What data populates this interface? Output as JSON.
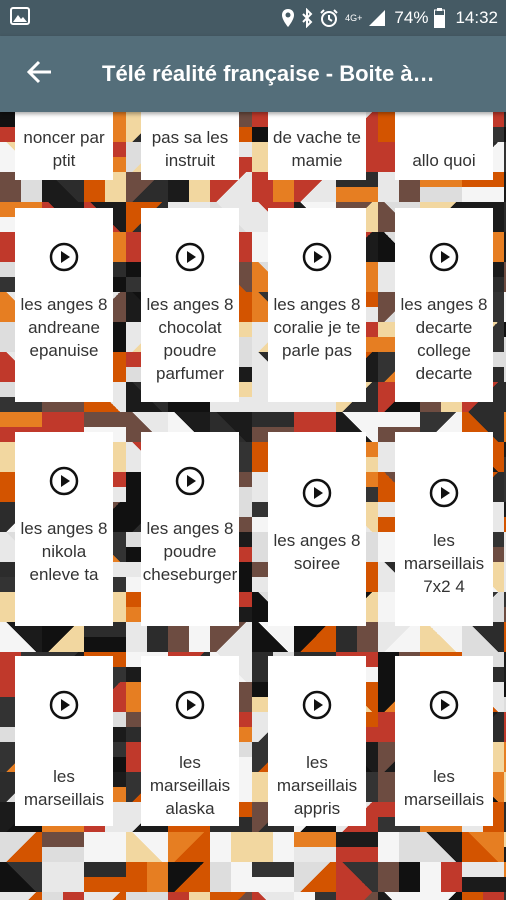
{
  "status_bar": {
    "network": "4G+",
    "battery_pct": "74%",
    "time": "14:32",
    "icons": [
      "image-icon",
      "location-icon",
      "bluetooth-icon",
      "alarm-icon",
      "signal-icon",
      "battery-icon"
    ]
  },
  "app_bar": {
    "title": "Télé réalité française - Boite à…",
    "back_icon": "arrow-left-icon",
    "color": "#546E7A"
  },
  "partial_row": [
    "noncer par ptit",
    "pas sa les instruit",
    "de vache te mamie",
    "allo quoi"
  ],
  "rows": [
    [
      "les anges 8 andreane epanuise",
      "les anges 8 chocolat poudre parfumer",
      "les anges 8 coralie je te parle pas",
      "les anges 8 decarte college decarte"
    ],
    [
      "les anges 8 nikola enleve ta",
      "les anges 8 poudre cheseburger",
      "les anges 8 soiree",
      "les marseillais 7x2 4"
    ],
    [
      "les marseillais",
      "les marseillais alaska",
      "les marseillais appris",
      "les marseillais"
    ]
  ],
  "item_icon": "play-circle-icon"
}
